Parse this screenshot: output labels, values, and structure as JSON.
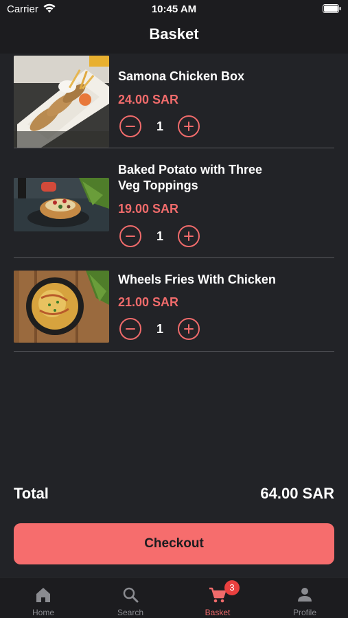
{
  "status_bar": {
    "carrier": "Carrier",
    "time": "10:45 AM"
  },
  "header": {
    "title": "Basket"
  },
  "items": [
    {
      "name": "Samona Chicken Box",
      "price": "24.00 SAR",
      "quantity": "1"
    },
    {
      "name": "Baked Potato with Three Veg Toppings",
      "price": "19.00 SAR",
      "quantity": "1"
    },
    {
      "name": "Wheels Fries With Chicken",
      "price": "21.00 SAR",
      "quantity": "1"
    }
  ],
  "summary": {
    "total_label": "Total",
    "total_value": "64.00 SAR",
    "checkout_label": "Checkout"
  },
  "tab_bar": {
    "tabs": [
      {
        "label": "Home",
        "icon": "home-icon"
      },
      {
        "label": "Search",
        "icon": "search-icon"
      },
      {
        "label": "Basket",
        "icon": "cart-icon",
        "badge": "3",
        "active": true
      },
      {
        "label": "Profile",
        "icon": "person-icon"
      }
    ]
  },
  "colors": {
    "background": "#222327",
    "bar_background": "#1c1c1f",
    "accent": "#f06b6b",
    "checkout_button": "#f66d6d",
    "badge": "#e9403f",
    "inactive_tab": "#8a8b90"
  }
}
